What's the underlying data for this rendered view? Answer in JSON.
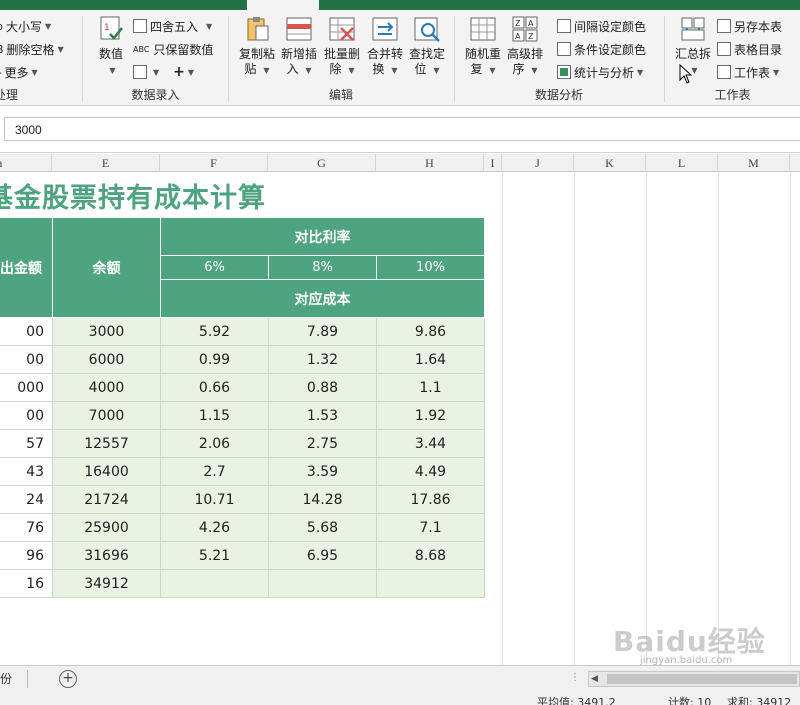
{
  "ribbon": {
    "left_group": {
      "items": [
        "大小写",
        "删除空格",
        "更多"
      ],
      "label": "处理"
    },
    "data_entry": {
      "numeric_label": "数值",
      "round_label": "四舍五入",
      "keep_numbers_label": "只保留数值",
      "group_label": "数据录入"
    },
    "edit": {
      "buttons": [
        {
          "top": "复制粘",
          "bottom": "贴"
        },
        {
          "top": "新增插",
          "bottom": "入"
        },
        {
          "top": "批量删",
          "bottom": "除"
        },
        {
          "top": "合并转",
          "bottom": "换"
        },
        {
          "top": "查找定",
          "bottom": "位"
        }
      ],
      "group_label": "编辑"
    },
    "analysis": {
      "buttons": [
        {
          "top": "随机重",
          "bottom": "复"
        },
        {
          "top": "高级排",
          "bottom": "序"
        }
      ],
      "items": [
        "间隔设定颜色",
        "条件设定颜色",
        "统计与分析"
      ],
      "group_label": "数据分析"
    },
    "worksheet": {
      "summary_label": "汇总拆",
      "items": [
        "另存本表",
        "表格目录",
        "工作表"
      ],
      "group_label": "工作表"
    }
  },
  "formula_bar": {
    "value": "3000"
  },
  "columns": [
    "E",
    "F",
    "G",
    "H",
    "I",
    "J",
    "K",
    "L",
    "M"
  ],
  "sheet": {
    "title": "基金股票持有成本计算",
    "headers": {
      "sell_amount": "卖出金额",
      "balance": "余额",
      "compare_rate": "对比利率",
      "rates": [
        "6%",
        "8%",
        "10%"
      ],
      "cost": "对应成本"
    },
    "rows": [
      {
        "d": "00",
        "e": "3000",
        "f": "5.92",
        "g": "7.89",
        "h": "9.86"
      },
      {
        "d": "00",
        "e": "6000",
        "f": "0.99",
        "g": "1.32",
        "h": "1.64"
      },
      {
        "d": "000",
        "e": "4000",
        "f": "0.66",
        "g": "0.88",
        "h": "1.1"
      },
      {
        "d": "00",
        "e": "7000",
        "f": "1.15",
        "g": "1.53",
        "h": "1.92"
      },
      {
        "d": "57",
        "e": "12557",
        "f": "2.06",
        "g": "2.75",
        "h": "3.44"
      },
      {
        "d": "43",
        "e": "16400",
        "f": "2.7",
        "g": "3.59",
        "h": "4.49"
      },
      {
        "d": "24",
        "e": "21724",
        "f": "10.71",
        "g": "14.28",
        "h": "17.86"
      },
      {
        "d": "76",
        "e": "25900",
        "f": "4.26",
        "g": "5.68",
        "h": "7.1"
      },
      {
        "d": "96",
        "e": "31696",
        "f": "5.21",
        "g": "6.95",
        "h": "8.68"
      },
      {
        "d": "16",
        "e": "34912",
        "f": "",
        "g": "",
        "h": ""
      }
    ]
  },
  "tabs": {
    "sheet_name": "份"
  },
  "status": {
    "average": "平均值: 3491.2",
    "count": "计数: 10",
    "sum": "求和: 34912"
  },
  "watermark": {
    "brand": "Baidu经验",
    "url": "jingyan.baidu.com"
  },
  "colors": {
    "ribbon_green": "#217346",
    "table_header": "#4ea380",
    "table_body": "#eaf2e3",
    "title": "#4ea380"
  }
}
